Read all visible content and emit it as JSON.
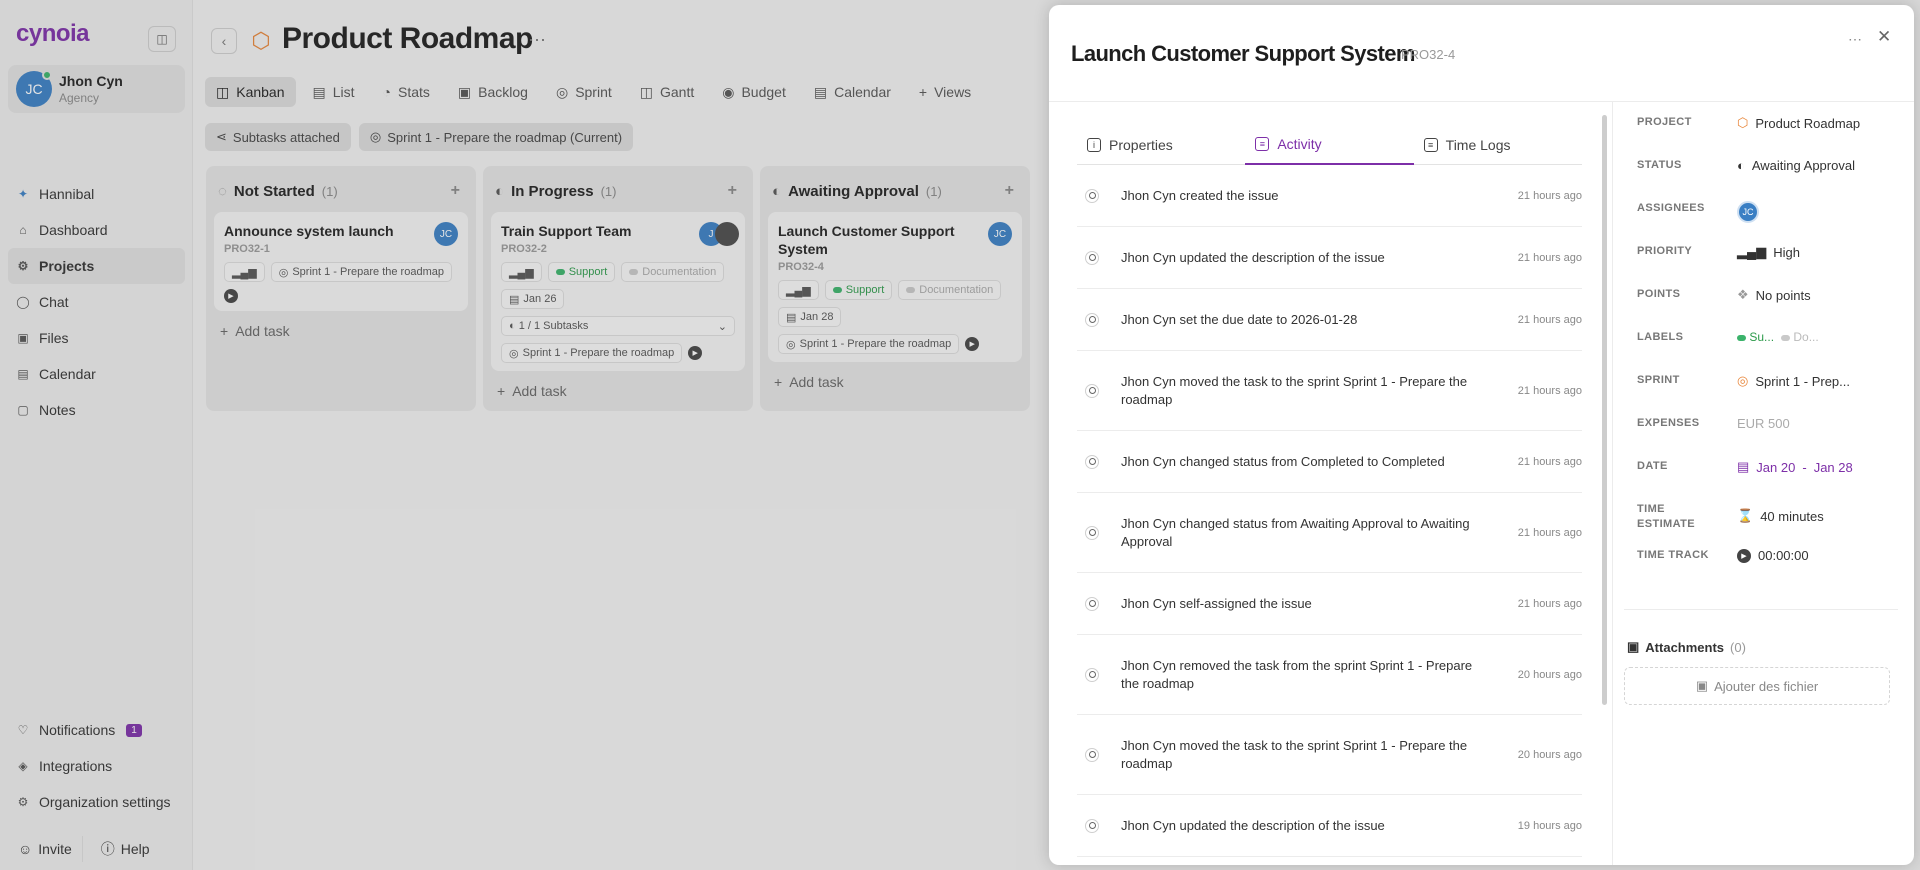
{
  "app": {
    "logo": "cynoia"
  },
  "user": {
    "initials": "JC",
    "name": "Jhon Cyn",
    "role": "Agency"
  },
  "nav": {
    "items": [
      {
        "label": "Hannibal",
        "icon": "sparkle-icon"
      },
      {
        "label": "Dashboard",
        "icon": "home-icon"
      },
      {
        "label": "Projects",
        "icon": "gear-icon"
      },
      {
        "label": "Chat",
        "icon": "chat-icon"
      },
      {
        "label": "Files",
        "icon": "folder-icon"
      },
      {
        "label": "Calendar",
        "icon": "calendar-icon"
      },
      {
        "label": "Notes",
        "icon": "note-icon"
      }
    ],
    "bottom": [
      {
        "label": "Notifications",
        "badge": "1"
      },
      {
        "label": "Integrations"
      },
      {
        "label": "Organization settings"
      }
    ],
    "invite": "Invite",
    "help": "Help"
  },
  "project": {
    "title": "Product Roadmap",
    "tabs": [
      "Kanban",
      "List",
      "Stats",
      "Backlog",
      "Sprint",
      "Gantt",
      "Budget",
      "Calendar",
      "Views"
    ],
    "filters": [
      "Subtasks attached",
      "Sprint 1 - Prepare the roadmap (Current)"
    ]
  },
  "board": {
    "columns": [
      {
        "title": "Not Started",
        "count": "(1)"
      },
      {
        "title": "In Progress",
        "count": "(1)"
      },
      {
        "title": "Awaiting Approval",
        "count": "(1)"
      }
    ],
    "add_task": "Add task",
    "cards": [
      {
        "title": "Announce system launch",
        "id": "PRO32-1",
        "avatar": "JC",
        "sprint": "Sprint 1 - Prepare the roadmap"
      },
      {
        "title": "Train Support Team",
        "id": "PRO32-2",
        "tag1": "Support",
        "tag2": "Documentation",
        "date": "Jan 26",
        "subtasks": "1 / 1 Subtasks",
        "sprint": "Sprint 1 - Prepare the roadmap"
      },
      {
        "title": "Launch Customer Support System",
        "id": "PRO32-4",
        "avatar": "JC",
        "tag1": "Support",
        "tag2": "Documentation",
        "date": "Jan 28",
        "sprint": "Sprint 1 - Prepare the roadmap"
      }
    ]
  },
  "drawer": {
    "title": "Launch Customer Support System",
    "id": "PRO32-4",
    "tabs": [
      "Properties",
      "Activity",
      "Time Logs"
    ],
    "activity": [
      {
        "text": "Jhon Cyn created the issue",
        "time": "21 hours ago"
      },
      {
        "text": "Jhon Cyn updated the description of the issue",
        "time": "21 hours ago"
      },
      {
        "text": "Jhon Cyn set the due date to 2026-01-28",
        "time": "21 hours ago"
      },
      {
        "text": "Jhon Cyn moved the task to the sprint Sprint 1 - Prepare the roadmap",
        "time": "21 hours ago"
      },
      {
        "text": "Jhon Cyn changed status from Completed to Completed",
        "time": "21 hours ago"
      },
      {
        "text": "Jhon Cyn changed status from Awaiting Approval to Awaiting Approval",
        "time": "21 hours ago"
      },
      {
        "text": "Jhon Cyn self-assigned the issue",
        "time": "21 hours ago"
      },
      {
        "text": "Jhon Cyn removed the task from the sprint Sprint 1 - Prepare the roadmap",
        "time": "20 hours ago"
      },
      {
        "text": "Jhon Cyn moved the task to the sprint Sprint 1 - Prepare the roadmap",
        "time": "20 hours ago"
      },
      {
        "text": "Jhon Cyn updated the description of the issue",
        "time": "19 hours ago"
      }
    ],
    "properties": {
      "project_label": "PROJECT",
      "project": "Product Roadmap",
      "status_label": "STATUS",
      "status": "Awaiting Approval",
      "assignees_label": "ASSIGNEES",
      "assignee": "JC",
      "priority_label": "PRIORITY",
      "priority": "High",
      "points_label": "POINTS",
      "points": "No points",
      "labels_label": "LABELS",
      "label1": "Su...",
      "label2": "Do...",
      "sprint_label": "SPRINT",
      "sprint": "Sprint 1 - Prep...",
      "expenses_label": "EXPENSES",
      "expenses": "EUR 500",
      "date_label": "DATE",
      "date_start": "Jan 20",
      "date_sep": "-",
      "date_end": "Jan 28",
      "estimate_label_1": "TIME",
      "estimate_label_2": "ESTIMATE",
      "estimate": "40 minutes",
      "track_label": "TIME TRACK",
      "track": "00:00:00"
    },
    "attachments_label": "Attachments",
    "attachments_count": "(0)",
    "add_files": "Ajouter des fichier"
  }
}
